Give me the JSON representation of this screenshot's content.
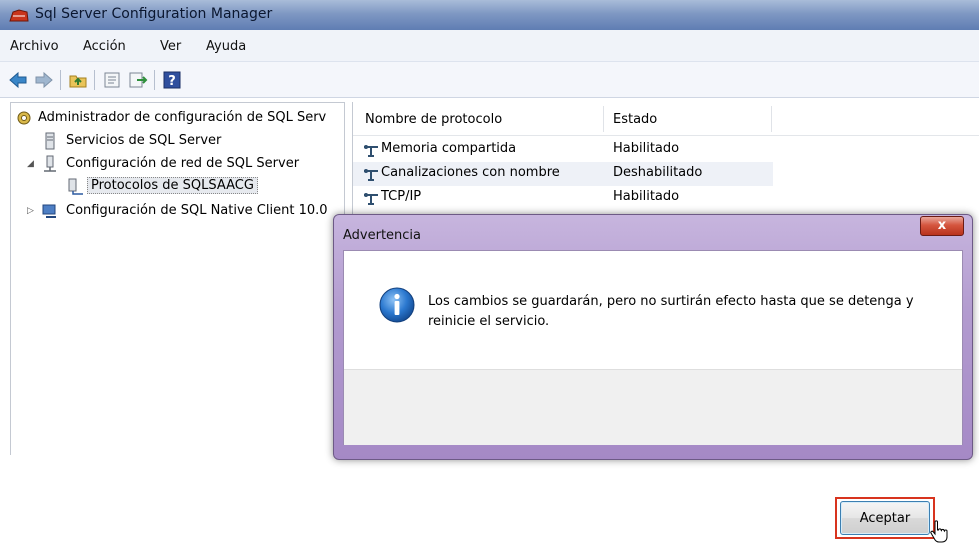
{
  "window": {
    "title": "Sql Server Configuration Manager"
  },
  "menu": {
    "items": [
      "Archivo",
      "Acción",
      "Ver",
      "Ayuda"
    ]
  },
  "toolbar": {
    "buttons": [
      "back-arrow-icon",
      "forward-arrow-icon",
      "folder-up-icon",
      "properties-icon",
      "export-icon",
      "help-icon"
    ]
  },
  "tree": {
    "items": [
      {
        "label": "Administrador de configuración de SQL Serv",
        "icon": "sql-config-icon"
      },
      {
        "label": "Servicios de SQL Server",
        "icon": "server-icon"
      },
      {
        "label": "Configuración de red de SQL Server",
        "icon": "network-config-icon"
      },
      {
        "label": "Protocolos de SQLSAACG",
        "icon": "protocols-icon"
      },
      {
        "label": "Configuración de SQL Native Client 10.0",
        "icon": "native-client-icon"
      }
    ]
  },
  "list": {
    "columns": [
      "Nombre de protocolo",
      "Estado"
    ],
    "rows": [
      {
        "name": "Memoria compartida",
        "status": "Habilitado"
      },
      {
        "name": "Canalizaciones con nombre",
        "status": "Deshabilitado"
      },
      {
        "name": "TCP/IP",
        "status": "Habilitado"
      }
    ]
  },
  "dialog": {
    "title": "Advertencia",
    "close_label": "x",
    "message": "Los cambios se guardarán, pero no surtirán efecto hasta que se detenga y reinicie el servicio.",
    "ok_label": "Aceptar",
    "icon": "info-icon"
  },
  "colors": {
    "dialog_frame": "#b29bcf",
    "highlight_box": "#d8341e",
    "title_bar": "#7f98c3"
  }
}
